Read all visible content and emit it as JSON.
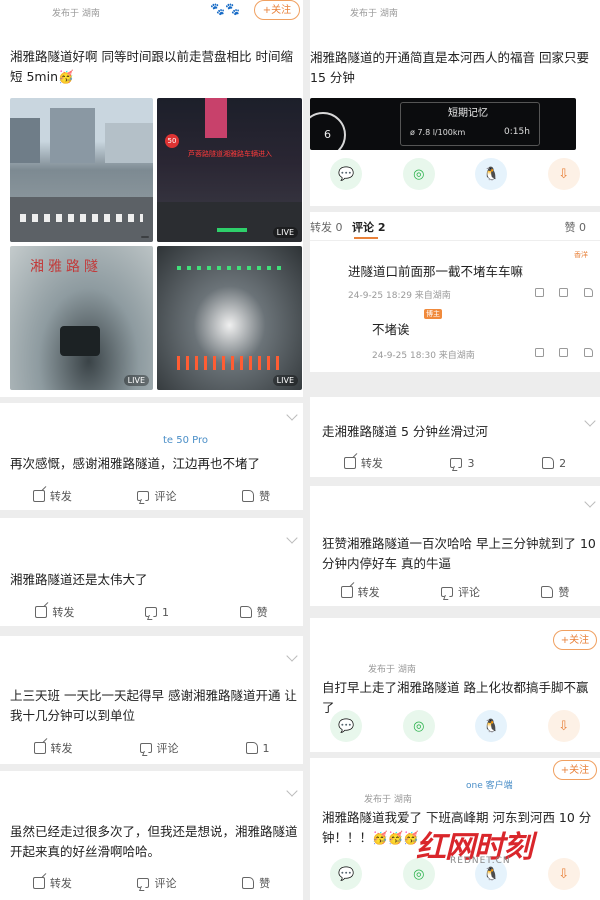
{
  "left": {
    "top_post": {
      "location": "发布于 湖南",
      "follow": "+关注",
      "text": "湘雅路隧道好啊 同等时间跟以前走营盘相比 时间缩短 5min",
      "emoji": "🥳",
      "photos": [
        {
          "caption": "",
          "live": ""
        },
        {
          "caption": "芦蓉路隧道湘雅路车辆进入",
          "live": "LIVE"
        },
        {
          "caption": "湘雅路隧",
          "live": "LIVE"
        },
        {
          "caption": "",
          "live": "LIVE"
        }
      ]
    },
    "device": "te 50 Pro",
    "posts": [
      {
        "text": "再次感慨，感谢湘雅路隧道，江边再也不堵了",
        "repost": "转发",
        "comment": "评论",
        "like": "赞"
      },
      {
        "text": "湘雅路隧道还是太伟大了",
        "repost": "转发",
        "comment": "1",
        "like": "赞"
      },
      {
        "text": "上三天班 一天比一天起得早 感谢湘雅路隧道开通 让我十几分钟可以到单位",
        "repost": "转发",
        "comment": "评论",
        "like": "1"
      },
      {
        "text": "虽然已经走过很多次了，但我还是想说，湘雅路隧道开起来真的好丝滑啊哈哈。",
        "repost": "转发",
        "comment": "评论",
        "like": "赞"
      }
    ]
  },
  "right": {
    "top_post": {
      "location": "发布于 湖南",
      "text": "湘雅路隧道的开通简直是本河西人的福音 回家只要 15 分钟",
      "dash": {
        "title": "短期记忆",
        "consumption": "7.8 l/100km",
        "time": "0:15h",
        "gauge": "6"
      }
    },
    "tabs": {
      "repost": "转发 0",
      "comment": "评论 2",
      "like": "赞 0"
    },
    "comments": [
      {
        "text": "进隧道口前面那一截不堵车车嘛",
        "meta": "24-9-25 18:29 来自湖南",
        "badge": "香洋"
      },
      {
        "text": "不堵诶",
        "meta": "24-9-25 18:30 来自湖南",
        "badge": "博主"
      }
    ],
    "posts": [
      {
        "text": "走湘雅路隧道 5 分钟丝滑过河",
        "repost": "转发",
        "comment": "3",
        "like": "2"
      },
      {
        "text": "狂赞湘雅路隧道一百次哈哈 早上三分钟就到了 10 分钟内停好车 真的牛逼",
        "repost": "转发",
        "comment": "评论",
        "like": "赞"
      }
    ],
    "post4": {
      "location": "发布于 湖南",
      "follow": "+关注",
      "text": "自打早上走了湘雅路隧道 路上化妆都搞手脚不赢了"
    },
    "post5": {
      "location": "发布于 湖南",
      "client": "one 客户端",
      "follow": "+关注",
      "text": "湘雅路隧道我爱了 下班高峰期 河东到河西 10 分钟！！！",
      "emoji": "🥳🥳🥳"
    }
  },
  "watermark": {
    "brand": "红网时刻",
    "site": "REDNET.CN"
  },
  "colors": {
    "accent": "#e8813a",
    "brand_red": "#d9262b"
  }
}
